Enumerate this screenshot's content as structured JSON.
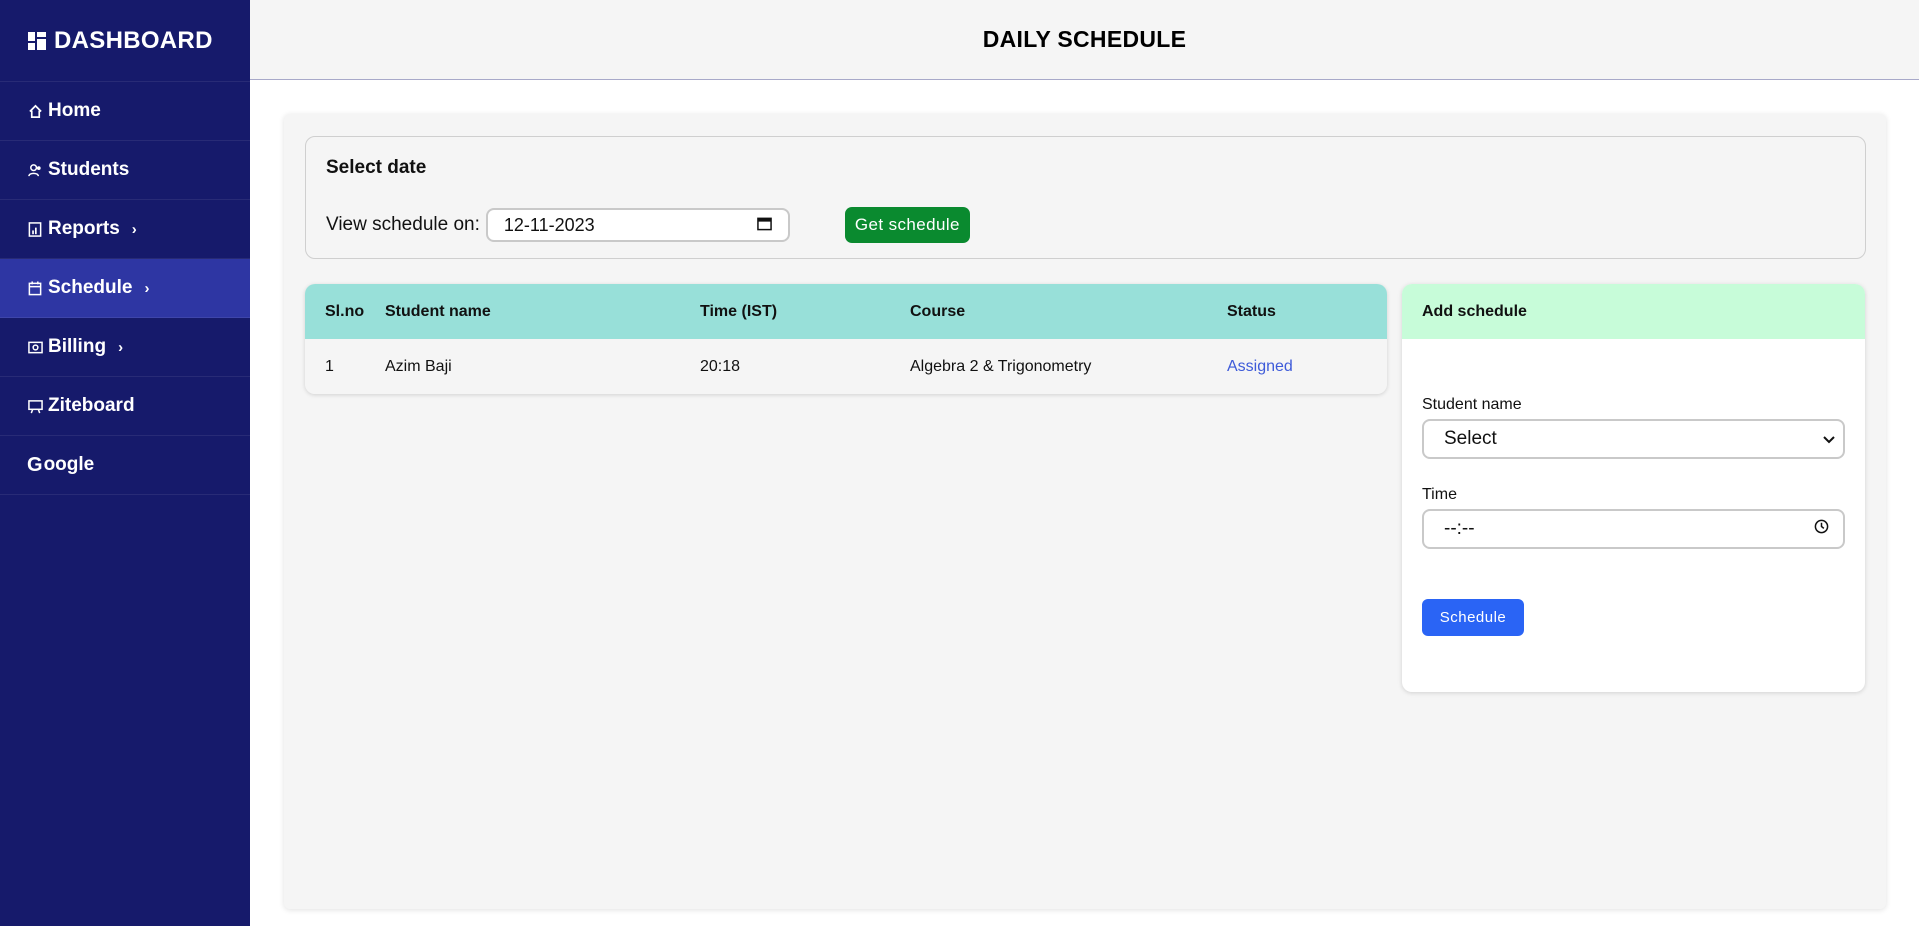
{
  "sidebar": {
    "brand": "DASHBOARD",
    "items": [
      {
        "label": "Home",
        "icon": "home-icon"
      },
      {
        "label": "Students",
        "icon": "users-icon"
      },
      {
        "label": "Reports",
        "icon": "report-icon",
        "chevron": "›"
      },
      {
        "label": "Schedule",
        "icon": "calendar-icon",
        "chevron": "›",
        "active": true
      },
      {
        "label": "Billing",
        "icon": "money-icon",
        "chevron": "›"
      },
      {
        "label": "Ziteboard",
        "icon": "whiteboard-icon"
      },
      {
        "label": "oogle",
        "icon_letter": "G"
      }
    ]
  },
  "header": {
    "title": "DAILY SCHEDULE"
  },
  "date_card": {
    "title": "Select date",
    "view_label": "View schedule on:",
    "date_value": "12-11-2023",
    "button": "Get schedule"
  },
  "table": {
    "headers": [
      "Sl.no",
      "Student name",
      "Time (IST)",
      "Course",
      "Status"
    ],
    "rows": [
      [
        "1",
        "Azim Baji",
        "20:18",
        "Algebra 2 & Trigonometry",
        "Assigned"
      ]
    ]
  },
  "add_schedule": {
    "title": "Add schedule",
    "student_label": "Student name",
    "student_selected": "Select",
    "time_label": "Time",
    "time_value": "--:--",
    "button": "Schedule"
  },
  "colors": {
    "sidebar_bg": "#161a6b",
    "sidebar_active": "#2e36a3",
    "table_header": "#98e0d9",
    "add_header": "#c7fcd9",
    "get_button": "#0a8a2f",
    "schedule_button": "#2a64f5",
    "status_assigned": "#3e5bd9"
  }
}
